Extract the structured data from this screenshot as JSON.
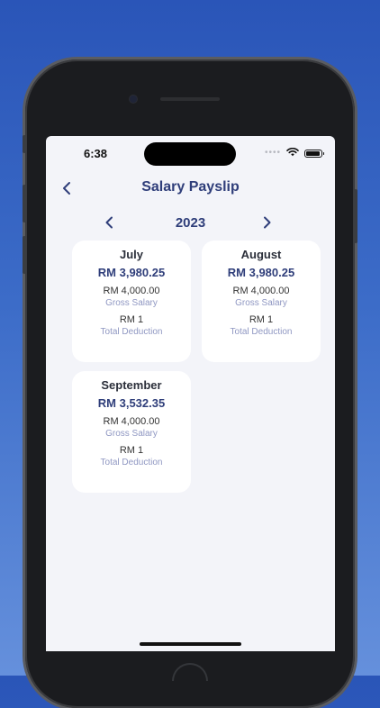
{
  "status_bar": {
    "time": "6:38",
    "signal_dots": "••••",
    "wifi_icon": "wifi-icon",
    "battery_icon": "battery-icon"
  },
  "header": {
    "title": "Salary Payslip",
    "back_icon": "chevron-left-icon"
  },
  "year_selector": {
    "year": "2023",
    "prev_icon": "chevron-left-icon",
    "next_icon": "chevron-right-icon"
  },
  "payslips": [
    {
      "month": "July",
      "net": "RM 3,980.25",
      "gross_value": "RM 4,000.00",
      "gross_label": "Gross Salary",
      "deduction_value": "RM 1",
      "deduction_label": "Total Deduction"
    },
    {
      "month": "August",
      "net": "RM 3,980.25",
      "gross_value": "RM 4,000.00",
      "gross_label": "Gross Salary",
      "deduction_value": "RM 1",
      "deduction_label": "Total Deduction"
    },
    {
      "month": "September",
      "net": "RM 3,532.35",
      "gross_value": "RM 4,000.00",
      "gross_label": "Gross Salary",
      "deduction_value": "RM 1",
      "deduction_label": "Total Deduction"
    }
  ],
  "colors": {
    "accent": "#2f3e7a",
    "muted_label": "#8f97c2",
    "screen_bg": "#f3f4f9",
    "card_bg": "#ffffff"
  }
}
